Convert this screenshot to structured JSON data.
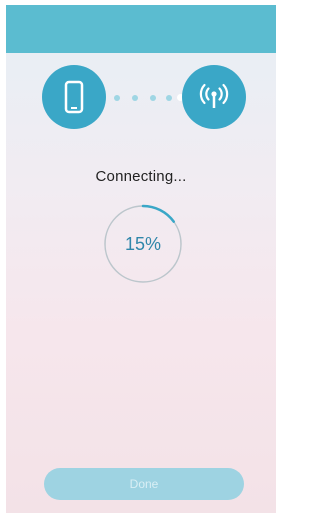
{
  "status": {
    "text": "Connecting..."
  },
  "progress": {
    "fraction": 0.15,
    "label": "15%"
  },
  "footer": {
    "done_label": "Done",
    "done_enabled": false
  },
  "icons": {
    "left": "phone-icon",
    "right": "router-signal-icon"
  },
  "colors": {
    "header": "#5bbcd0",
    "icon_circle": "#3aa7c7",
    "progress_arc": "#3aa7c7",
    "button_disabled": "#9ed3e2"
  }
}
